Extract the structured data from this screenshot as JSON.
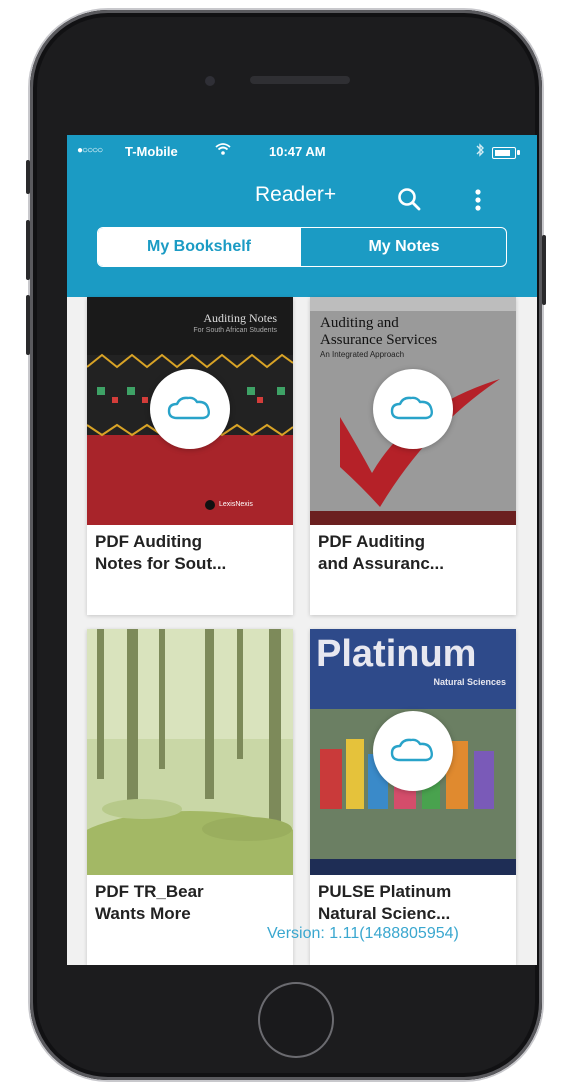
{
  "status_bar": {
    "signal": "●○○○○",
    "carrier": "T-Mobile",
    "time": "10:47 AM",
    "battery_level": 0.85
  },
  "app_bar": {
    "title": "Reader+",
    "search_icon": "search-icon",
    "menu_icon": "more-vertical-icon",
    "tabs": [
      {
        "label": "My Bookshelf",
        "selected": true
      },
      {
        "label": "My Notes",
        "selected": false
      }
    ]
  },
  "books": [
    {
      "title_line1": "PDF Auditing",
      "title_line2": "Notes for Sout...",
      "cover_title": "Auditing Notes",
      "cover_subtitle": "For South African Students",
      "cover_publisher": "LexisNexis",
      "cloud": true
    },
    {
      "title_line1": "PDF Auditing",
      "title_line2": "and Assuranc...",
      "cover_title_1": "Auditing and",
      "cover_title_2": "Assurance Services",
      "cover_subtitle": "An Integrated Approach",
      "cloud": true
    },
    {
      "title_line1": "PDF TR_Bear",
      "title_line2": "Wants More",
      "cloud": false
    },
    {
      "title_line1": "PULSE Platinum",
      "title_line2": "Natural Scienc...",
      "cover_title": "Platinum",
      "cover_subtitle": "Natural Sciences",
      "cloud": true
    }
  ],
  "version": "Version: 1.11(1488805954)",
  "colors": {
    "accent": "#1b9bc4",
    "cloud_icon": "#29a3c9"
  }
}
